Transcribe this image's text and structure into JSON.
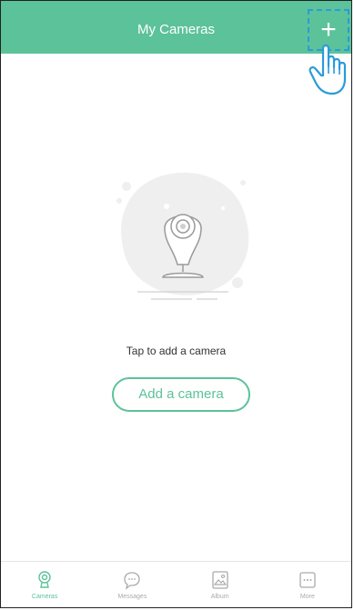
{
  "header": {
    "title": "My Cameras",
    "add_label": "+"
  },
  "empty_state": {
    "message": "Tap to add a camera",
    "button_label": "Add a camera"
  },
  "tabbar": {
    "items": [
      {
        "label": "Cameras",
        "icon": "camera-icon",
        "active": true
      },
      {
        "label": "Messages",
        "icon": "chat-bubble-icon",
        "active": false
      },
      {
        "label": "Album",
        "icon": "image-icon",
        "active": false
      },
      {
        "label": "More",
        "icon": "more-dots-icon",
        "active": false
      }
    ]
  },
  "colors": {
    "accent": "#5cc29a",
    "highlight": "#2a9bd8"
  }
}
